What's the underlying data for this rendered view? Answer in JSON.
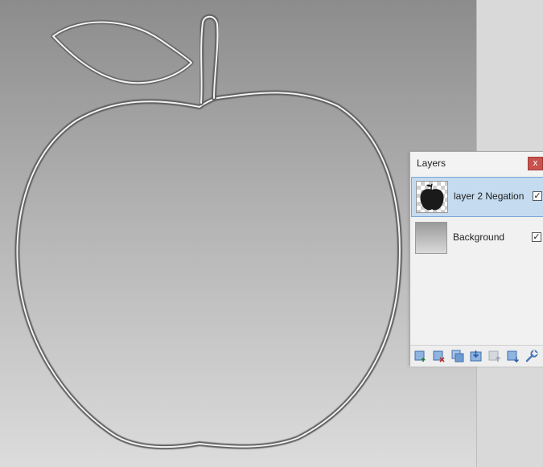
{
  "panel": {
    "title": "Layers",
    "close_glyph": "x",
    "layers": [
      {
        "name": "layer 2 Negation",
        "visible": true,
        "selected": true,
        "thumb_icon": "apple-silhouette-icon"
      },
      {
        "name": "Background",
        "visible": true,
        "selected": false,
        "thumb_icon": "gradient-thumbnail"
      }
    ],
    "checkmark": "✓",
    "toolbar_icons": [
      "add-layer-icon",
      "delete-layer-icon",
      "duplicate-layer-icon",
      "merge-layer-down-icon",
      "move-layer-up-icon",
      "move-layer-down-icon",
      "layer-properties-icon"
    ]
  },
  "colors": {
    "selection_fill": "#c5dbef",
    "selection_border": "#7aa7d6",
    "close_button": "#c9524f",
    "toolbar_icon_blue": "#4a78b8"
  }
}
